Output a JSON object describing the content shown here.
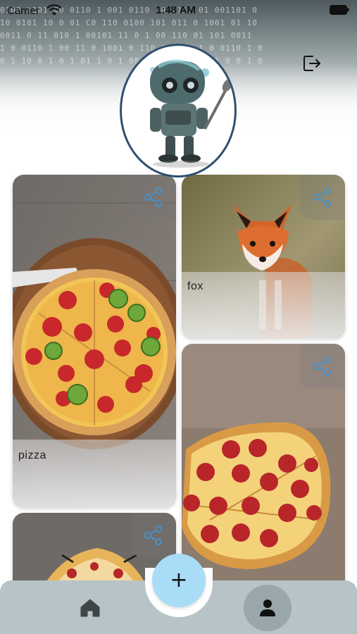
{
  "status_bar": {
    "carrier": "Carrier",
    "time": "1:48 AM",
    "icons": [
      "wifi-icon",
      "battery-icon"
    ]
  },
  "header": {
    "background_style": "digital matrix pattern",
    "matrix_text": [
      "0100 1101 00 0110 1 001 0110 10 0111 01 001101 0",
      "10 0101 10 0 01 C0 110 0100 101 011 0 1001 01 10",
      "0011 0 11 010 1 00101 11 0 1 00 110 01 101 0011",
      "1 0 0110 1 00 11 0 1001 0 110 1 0 01 1 0 0110 1 0",
      "0 1 10 0 1 0 1 01 1 0 1 00 1 0 1 1 0 10 1 0 0 1 0"
    ],
    "logout_icon": "logout-icon",
    "avatar_alt": "robot character avatar"
  },
  "cards": [
    {
      "label": "pizza",
      "image": "pepper-pizza-photo",
      "share_icon": "share-icon"
    },
    {
      "label": "fox",
      "image": "red-fox-photo",
      "share_icon": "share-icon"
    },
    {
      "label": "",
      "image": "pepperoni-pizza-photo",
      "share_icon": "share-icon"
    },
    {
      "label": "",
      "image": "pizza-photo-partial",
      "share_icon": "share-icon"
    }
  ],
  "bottom_nav": {
    "fab_label": "+",
    "home_icon": "home-icon",
    "profile_icon": "profile-icon"
  },
  "colors": {
    "fab": "#a9dcf7",
    "nav_background": "#b7c3c7",
    "profile_active": "#99a6aa",
    "share_icon": "#4a90c8",
    "avatar_border": "#2f4f6f"
  }
}
